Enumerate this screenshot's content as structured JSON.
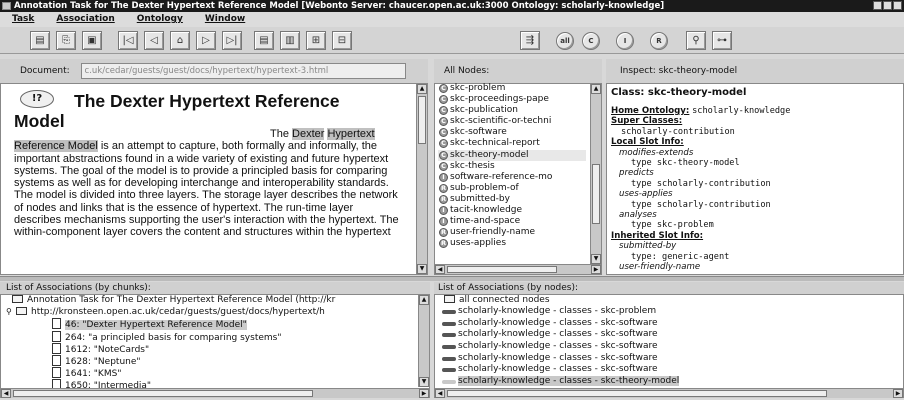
{
  "window": {
    "title": "Annotation Task for The Dexter Hypertext Reference Model [Webonto Server: chaucer.open.ac.uk:3000  Ontology: scholarly-knowledge]"
  },
  "menu": [
    "Task",
    "Association",
    "Ontology",
    "Window"
  ],
  "document": {
    "label": "Document:",
    "url": "c.uk/cedar/guests/guest/docs/hypertext/hypertext-3.html",
    "icon_text": "!?",
    "title": "The Dexter Hypertext Reference Model",
    "body_pre": "The ",
    "body_hl1": "Dexter",
    "body_hl2": "Hypertext Reference Model",
    "body_post": " is an attempt to capture, both formally and informally, the important abstractions found in a wide variety of existing and future hypertext systems. The goal of the model is to provide a principled basis for comparing systems as well as for developing interchange and interoperability standards. The model is divided into three layers. The storage layer describes the network of nodes and links that is the essence of hypertext. The run-time layer describes mechanisms supporting the user's interaction with the hypertext. The within-component layer covers the content and structures within the hypertext"
  },
  "nodes": {
    "label": "All Nodes:",
    "items": [
      {
        "badge": "C",
        "label": "skc-problem"
      },
      {
        "badge": "C",
        "label": "skc-proceedings-pape"
      },
      {
        "badge": "C",
        "label": "skc-publication"
      },
      {
        "badge": "C",
        "label": "skc-scientific-or-techni"
      },
      {
        "badge": "C",
        "label": "skc-software"
      },
      {
        "badge": "C",
        "label": "skc-technical-report"
      },
      {
        "badge": "C",
        "label": "skc-theory-model",
        "selected": true
      },
      {
        "badge": "C",
        "label": "skc-thesis"
      },
      {
        "badge": "I",
        "label": "software-reference-mo"
      },
      {
        "badge": "R",
        "label": "sub-problem-of"
      },
      {
        "badge": "R",
        "label": "submitted-by"
      },
      {
        "badge": "I",
        "label": "tacit-knowledge"
      },
      {
        "badge": "I",
        "label": "time-and-space"
      },
      {
        "badge": "R",
        "label": "user-friendly-name"
      },
      {
        "badge": "R",
        "label": "uses-applies"
      }
    ]
  },
  "inspect": {
    "label": "Inspect: skc-theory-model",
    "class_title": "Class: skc-theory-model",
    "home_label": "Home Ontology:",
    "home_value": "scholarly-knowledge",
    "super_label": "Super Classes:",
    "super_value": "scholarly-contribution",
    "local_label": "Local Slot Info:",
    "s1": "modifies-extends",
    "s1t": "type skc-theory-model",
    "s2": "predicts",
    "s2t": "type scholarly-contribution",
    "s3": "uses-applies",
    "s3t": "type scholarly-contribution",
    "s4": "analyses",
    "s4t": "type skc-problem",
    "inherited_label": "Inherited Slot Info:",
    "s5": "submitted-by",
    "s5t": "type: generic-agent",
    "s6": "user-friendly-name"
  },
  "chunks": {
    "label": "List of Associations (by chunks):",
    "root": "Annotation Task for The Dexter Hypertext Reference Model (http://kr",
    "url": "http://kronsteen.open.ac.uk/cedar/guests/guest/docs/hypertext/h",
    "items": [
      "46: \"Dexter Hypertext Reference Model\"",
      "264: \"a principled basis for comparing systems\"",
      "1612: \"NoteCards\"",
      "1628: \"Neptune\"",
      "1641: \"KMS\"",
      "1650: \"Intermedia\""
    ]
  },
  "by_nodes": {
    "label": "List of Associations (by nodes):",
    "root": "all connected nodes",
    "items": [
      "scholarly-knowledge - classes - skc-problem",
      "scholarly-knowledge - classes - skc-software",
      "scholarly-knowledge - classes - skc-software",
      "scholarly-knowledge - classes - skc-software",
      "scholarly-knowledge - classes - skc-software",
      "scholarly-knowledge - classes - skc-software",
      "scholarly-knowledge - classes - skc-theory-model"
    ]
  },
  "toolbar": {
    "round_labels": [
      "all",
      "C",
      "I",
      "R"
    ]
  }
}
